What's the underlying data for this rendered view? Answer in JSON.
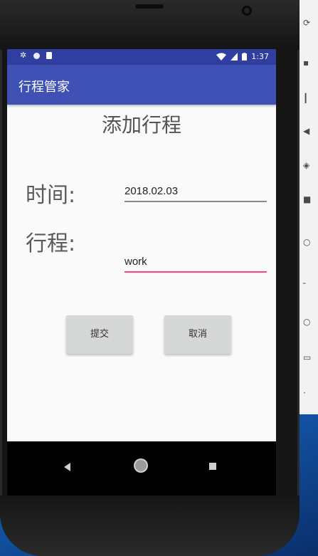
{
  "status_bar": {
    "time": "1:37"
  },
  "app_bar": {
    "title": "行程管家"
  },
  "page": {
    "title": "添加行程"
  },
  "form": {
    "time_label": "时间:",
    "time_value": "2018.02.03",
    "trip_label": "行程:",
    "trip_value": "work"
  },
  "buttons": {
    "submit": "提交",
    "cancel": "取消"
  },
  "colors": {
    "status_bar": "#303f9f",
    "app_bar": "#3f51b5",
    "focused_underline": "#ff4081",
    "inactive_underline": "#8a8a8a"
  },
  "icons": {
    "nav": [
      "back-icon",
      "home-icon",
      "recents-icon"
    ],
    "status": [
      "settings-icon",
      "circle-icon",
      "sim-icon",
      "wifi-icon",
      "signal-icon",
      "battery-icon"
    ]
  }
}
